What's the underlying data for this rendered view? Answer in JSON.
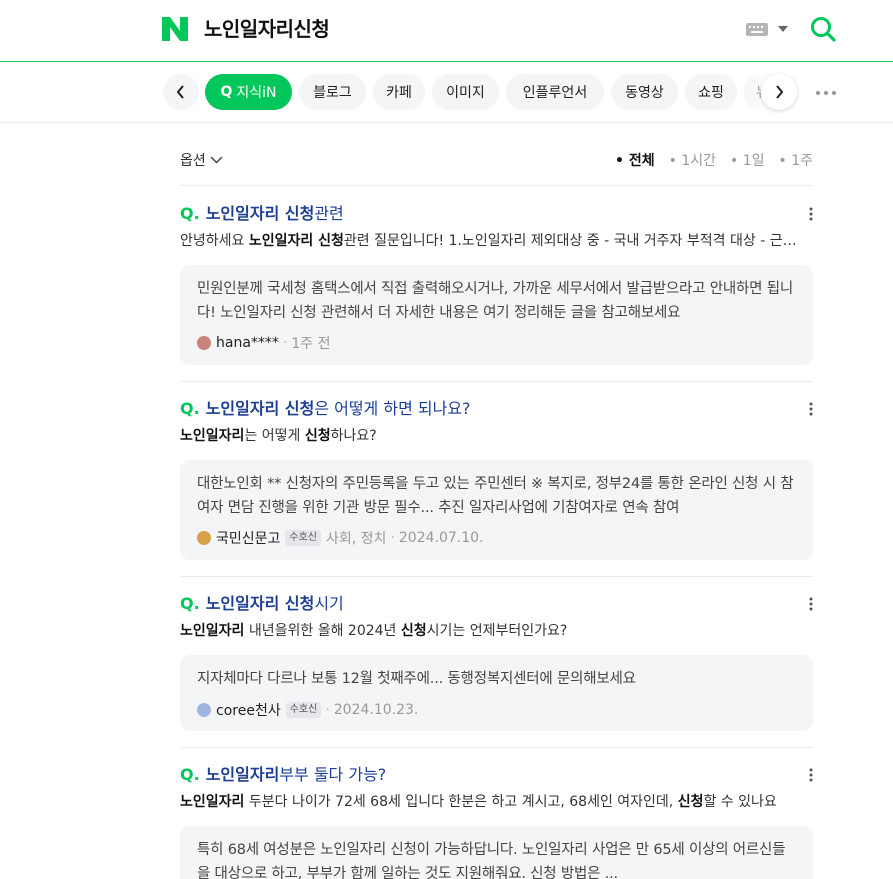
{
  "header": {
    "logo_letter": "N",
    "search_query": "노인일자리신청",
    "brand_color": "#03c75a"
  },
  "tabs": {
    "items": [
      {
        "label": "지식iN",
        "active": true
      },
      {
        "label": "블로그"
      },
      {
        "label": "카페"
      },
      {
        "label": "이미지"
      },
      {
        "label": "인플루언서"
      },
      {
        "label": "동영상"
      },
      {
        "label": "쇼핑"
      },
      {
        "label": "뉴"
      }
    ],
    "icons": [
      "chevron-left-icon",
      "chevron-right-icon",
      "more-dots-icon"
    ]
  },
  "options": {
    "label": "옵션",
    "time_filters": [
      "• 전체",
      "• 1시간",
      "• 1일",
      "• 1주"
    ],
    "selected": "• 전체"
  },
  "results": [
    {
      "q": "Q.",
      "title_highlight": "노인일자리 신청",
      "title_rest": "관련",
      "desc_parts": [
        "안녕하세요 ",
        "노인일자리 신청",
        "관련 질문입니다! 1.노인일자리 제외대상 중 - 국내 거주자 부적격 대상 - 근로소득"
      ],
      "answer": "민원인분께 국세청 홈택스에서 직접 출력해오시거나, 가까운 세무서에서 발급받으라고 안내하면 됩니다! 노인일자리 신청 관련해서 더 자세한 내용은 여기 정리해둔 글을 참고해보세요",
      "author": "hana****",
      "badge": "",
      "category": "",
      "date": "1주 전"
    },
    {
      "q": "Q.",
      "title_highlight": "노인일자리 신청",
      "title_rest": "은 어떻게 하면 되나요?",
      "desc_parts": [
        "",
        "노인일자리",
        "는 어떻게 ",
        "신청",
        "하나요?"
      ],
      "answer": "대한노인회 ** 신청자의 주민등록을 두고 있는 주민센터 ※ 복지로, 정부24를 통한 온라인 신청 시 참여자 면담 진행을 위한 기관 방문 필수... 추진 일자리사업에 기참여자로 연속 참여",
      "author": "국민신문고",
      "badge": "수호신",
      "category": "사회, 정치",
      "date": "2024.07.10."
    },
    {
      "q": "Q.",
      "title_highlight": "노인일자리 신청",
      "title_rest": "시기",
      "desc_parts": [
        "",
        "노인일자리",
        " 내년을위한 올해 2024년 ",
        "신청",
        "시기는 언제부터인가요?"
      ],
      "answer": "지자체마다 다르나 보통 12월 첫째주에... 동행정복지센터에 문의해보세요",
      "author": "coree천사",
      "badge": "수호신",
      "category": "",
      "date": "2024.10.23."
    },
    {
      "q": "Q.",
      "title_highlight": "노인일자리",
      "title_rest": " 부부 둘다 가능?",
      "desc_parts": [
        "",
        "노인일자리",
        " 두분다 나이가 72세 68세 입니다 한분은 하고 계시고, 68세인 여자인데, ",
        "신청",
        "할 수 있나요"
      ],
      "answer": "특히 68세 여성분은 노인일자리 신청이 가능하답니다. 노인일자리 사업은 만 65세 이상의 어르신들을 대상으로 하고, 부부가 함께 일하는 것도 지원해줘요. 신청 방법은 ...",
      "author": "",
      "badge": "",
      "category": "",
      "date": ""
    }
  ]
}
